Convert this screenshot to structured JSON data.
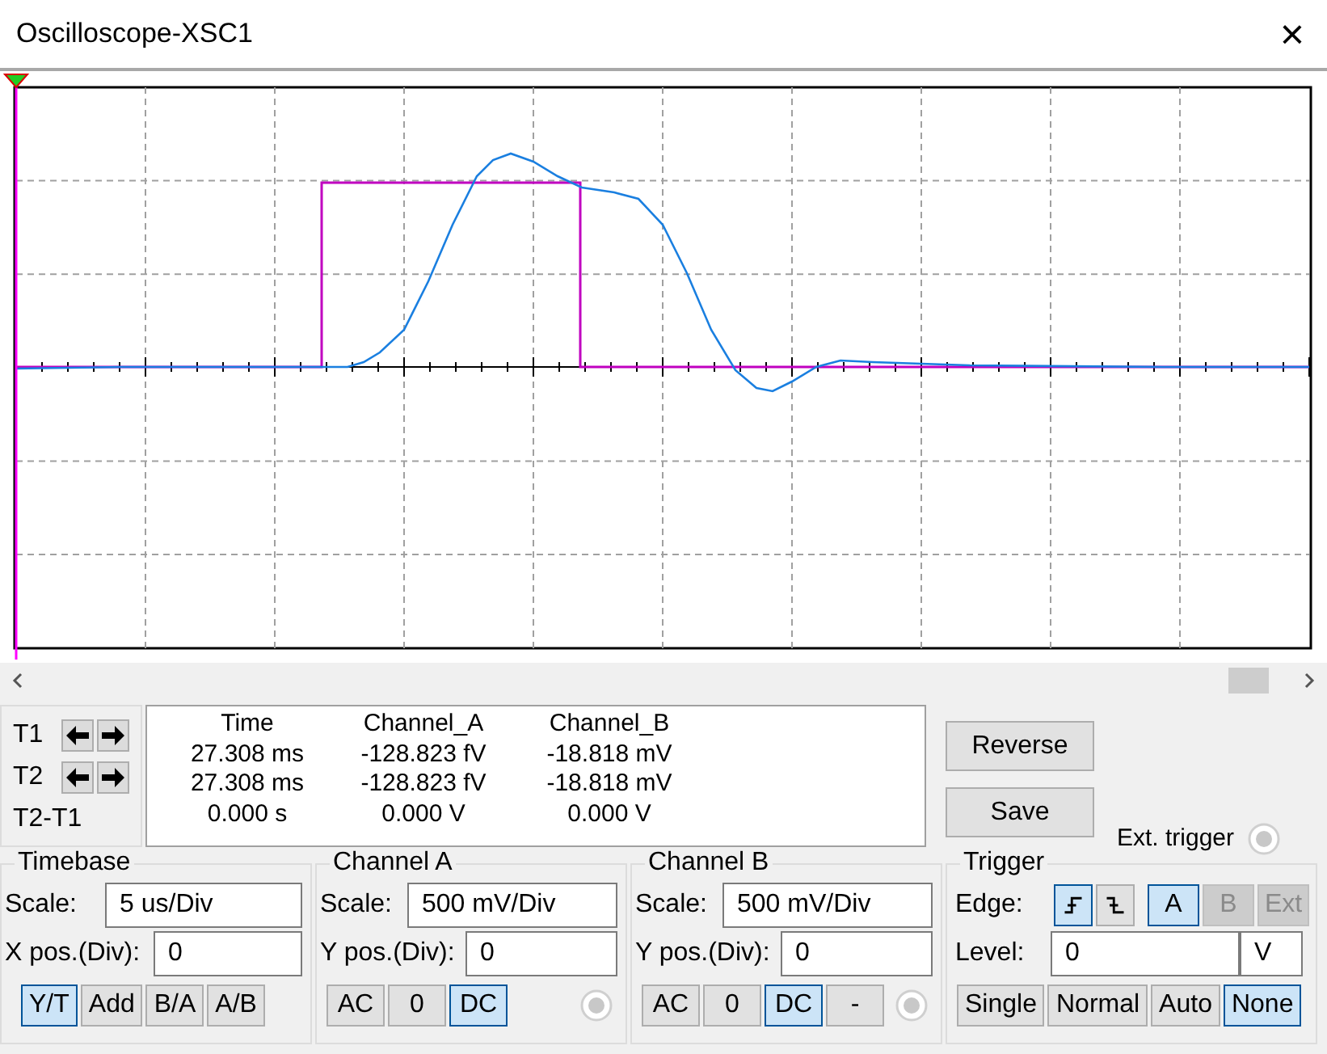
{
  "window": {
    "title": "Oscilloscope-XSC1",
    "close_label": "×"
  },
  "cursors": {
    "rows": [
      {
        "label": "T1",
        "arrows": true
      },
      {
        "label": "T2",
        "arrows": true
      },
      {
        "label": "T2-T1",
        "arrows": false
      }
    ]
  },
  "readout": {
    "columns": [
      "Time",
      "Channel_A",
      "Channel_B"
    ],
    "rows": [
      [
        "27.308 ms",
        "-128.823 fV",
        "-18.818 mV"
      ],
      [
        "27.308 ms",
        "-128.823 fV",
        "-18.818 mV"
      ],
      [
        "0.000 s",
        "0.000 V",
        "0.000 V"
      ]
    ]
  },
  "actions": [
    "Reverse",
    "Save"
  ],
  "ext_trigger": {
    "label": "Ext. trigger"
  },
  "timebase": {
    "title": "Timebase",
    "fields": [
      {
        "label": "Scale:",
        "value": "5 us/Div"
      },
      {
        "label": "X pos.(Div):",
        "value": "0"
      }
    ],
    "modes": [
      {
        "label": "Y/T",
        "selected": true
      },
      {
        "label": "Add",
        "selected": false
      },
      {
        "label": "B/A",
        "selected": false
      },
      {
        "label": "A/B",
        "selected": false
      }
    ]
  },
  "channels": [
    {
      "title": "Channel A",
      "fields": [
        {
          "label": "Scale:",
          "value": "500 mV/Div"
        },
        {
          "label": "Y pos.(Div):",
          "value": "0"
        }
      ],
      "coupling": [
        {
          "label": "AC",
          "selected": false
        },
        {
          "label": "0",
          "selected": false
        },
        {
          "label": "DC",
          "selected": true
        }
      ]
    },
    {
      "title": "Channel B",
      "fields": [
        {
          "label": "Scale:",
          "value": "500 mV/Div"
        },
        {
          "label": "Y pos.(Div):",
          "value": "0"
        }
      ],
      "coupling": [
        {
          "label": "AC",
          "selected": false
        },
        {
          "label": "0",
          "selected": false
        },
        {
          "label": "DC",
          "selected": true
        },
        {
          "label": "-",
          "selected": false
        }
      ]
    }
  ],
  "trigger": {
    "title": "Trigger",
    "edge_label": "Edge:",
    "edges": [
      {
        "kind": "rising",
        "selected": true
      },
      {
        "kind": "falling",
        "selected": false
      }
    ],
    "sources": [
      {
        "label": "A",
        "selected": true,
        "disabled": false
      },
      {
        "label": "B",
        "selected": false,
        "disabled": true
      },
      {
        "label": "Ext",
        "selected": false,
        "disabled": true
      }
    ],
    "level_label": "Level:",
    "level_value": "0",
    "level_unit": "V",
    "modes": [
      {
        "label": "Single",
        "selected": false
      },
      {
        "label": "Normal",
        "selected": false
      },
      {
        "label": "Auto",
        "selected": false
      },
      {
        "label": "None",
        "selected": true
      }
    ]
  }
}
